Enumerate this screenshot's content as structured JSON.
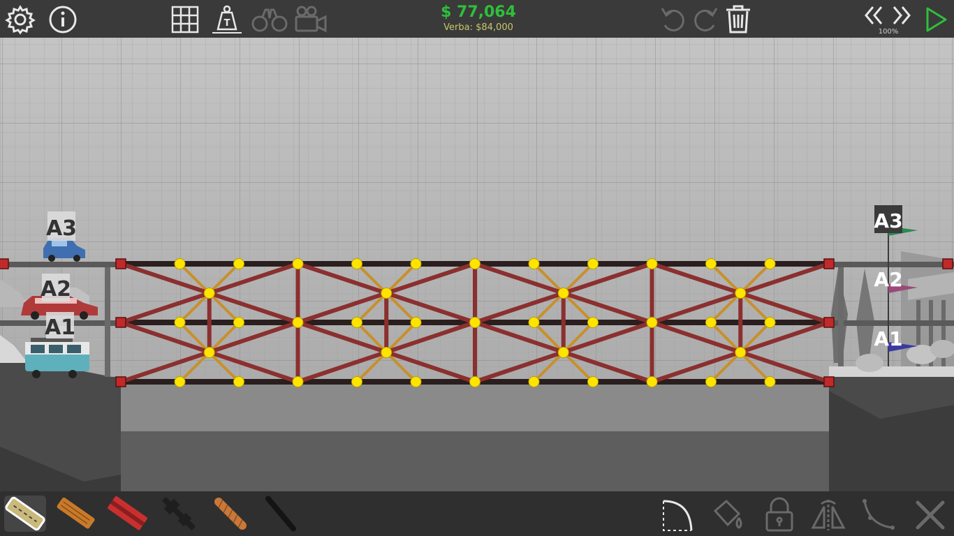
{
  "toolbar": {
    "left_icons": [
      "gear-icon",
      "info-icon"
    ],
    "view_icons": [
      "grid-icon",
      "weight-icon",
      "binoculars-icon",
      "camera-icon"
    ],
    "budget_amount": "$ 77,064",
    "budget_label": "Verba: $84,000",
    "edit_icons": [
      "undo-icon",
      "redo-icon",
      "trash-icon"
    ],
    "speed_icons": [
      "rewind-icon",
      "fast-forward-icon",
      "play-icon"
    ],
    "speed_value": "100%"
  },
  "vehicles_left": [
    {
      "label": "A3",
      "vehicle": "blue car"
    },
    {
      "label": "A2",
      "vehicle": "red station wagon"
    },
    {
      "label": "A1",
      "vehicle": "teal van"
    }
  ],
  "flags_right": [
    {
      "label": "A3",
      "color": "#2a8a52"
    },
    {
      "label": "A2",
      "color": "#9a4a78"
    },
    {
      "label": "A1",
      "color": "#3a3aa0"
    }
  ],
  "materials": [
    {
      "name": "road",
      "color": "#c9b97a",
      "selected": true
    },
    {
      "name": "wood",
      "color": "#c97a2a",
      "selected": false
    },
    {
      "name": "steel",
      "color": "#c83030",
      "selected": false
    },
    {
      "name": "hydraulic",
      "color": "#1e1e1e",
      "selected": false
    },
    {
      "name": "rope",
      "color": "#c9783a",
      "selected": false
    },
    {
      "name": "cable",
      "color": "#141414",
      "selected": false
    }
  ],
  "tools": [
    "arc-icon",
    "paint-bucket-icon",
    "lock-icon",
    "mirror-icon",
    "curve-icon",
    "close-icon"
  ],
  "colors": {
    "steel": "#8b2f2f",
    "road": "#2a1e1e",
    "rope": "#c8902a",
    "joint": "#ffe400",
    "anchor": "#c02a2a"
  }
}
